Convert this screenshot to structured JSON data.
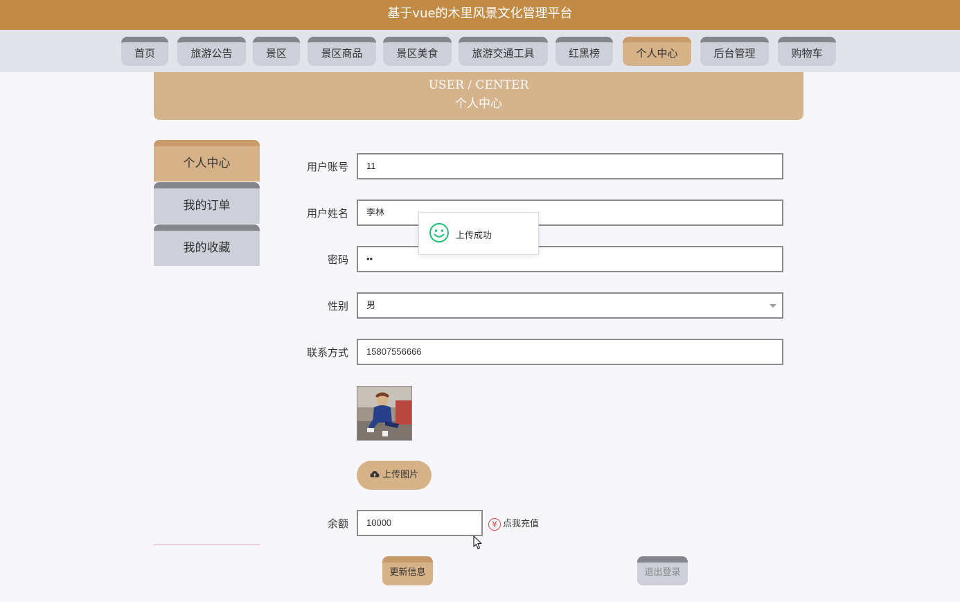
{
  "app": {
    "title": "基于vue的木里风景文化管理平台"
  },
  "nav": {
    "items": [
      {
        "label": "首页"
      },
      {
        "label": "旅游公告"
      },
      {
        "label": "景区"
      },
      {
        "label": "景区商品"
      },
      {
        "label": "景区美食"
      },
      {
        "label": "旅游交通工具"
      },
      {
        "label": "红黑榜"
      },
      {
        "label": "个人中心"
      },
      {
        "label": "后台管理"
      },
      {
        "label": "购物车"
      }
    ],
    "active": "个人中心"
  },
  "banner": {
    "en": "USER / CENTER",
    "cn": "个人中心"
  },
  "sidebar": {
    "items": [
      {
        "label": "个人中心"
      },
      {
        "label": "我的订单"
      },
      {
        "label": "我的收藏"
      }
    ]
  },
  "form": {
    "account": {
      "label": "用户账号",
      "value": "11"
    },
    "name": {
      "label": "用户姓名",
      "value": "李林"
    },
    "password": {
      "label": "密码",
      "value": "••"
    },
    "gender": {
      "label": "性别",
      "value": "男"
    },
    "phone": {
      "label": "联系方式",
      "value": "15807556666"
    },
    "upload_label": "上传图片",
    "balance": {
      "label": "余额",
      "value": "10000"
    },
    "recharge_label": "点我充值",
    "recharge_icon": "¥"
  },
  "actions": {
    "update": "更新信息",
    "logout": "退出登录"
  },
  "toast": {
    "message": "上传成功"
  },
  "colors": {
    "brand": "#c18a45",
    "accent": "#d5b288",
    "toast_icon": "#1dbf73"
  }
}
